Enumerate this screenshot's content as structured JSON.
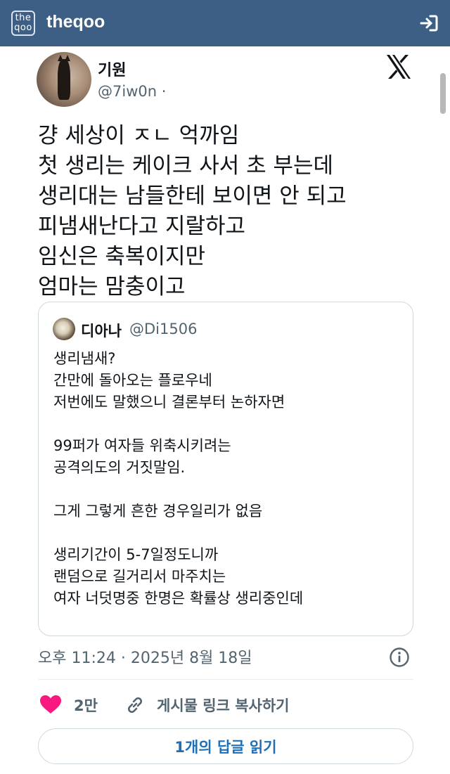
{
  "header": {
    "logo_top": "the",
    "logo_bottom": "qoo",
    "brand": "theqoo"
  },
  "tweet": {
    "display_name": "기원",
    "handle": "@7iw0n ·",
    "text": "걍 세상이 ㅈㄴ 억까임\n첫 생리는 케이크 사서 초 부는데\n생리대는 남들한테 보이면 안 되고\n피냄새난다고 지랄하고\n임신은 축복이지만\n엄마는 맘충이고",
    "timestamp": "오후 11:24 · 2025년 8월 18일",
    "likes": "2만",
    "copy_link_label": "게시물 링크 복사하기",
    "read_replies_label": "1개의 답글 읽기"
  },
  "quote": {
    "display_name": "디아나",
    "handle": "@Di1506",
    "text": "생리냄새?\n간만에 돌아오는 플로우네\n저번에도 말했으니 결론부터 논하자면\n\n99퍼가 여자들 위축시키려는\n공격의도의 거짓말임.\n\n그게 그렇게 흔한 경우일리가 없음\n\n생리기간이 5-7일정도니까\n랜덤으로 길거리서 마주치는\n여자 너덧명중 한명은 확률상 생리중인데"
  },
  "colors": {
    "topbar": "#3d5f86",
    "like": "#f91880",
    "link_blue": "#1d6fb8",
    "secondary_text": "#536471"
  }
}
